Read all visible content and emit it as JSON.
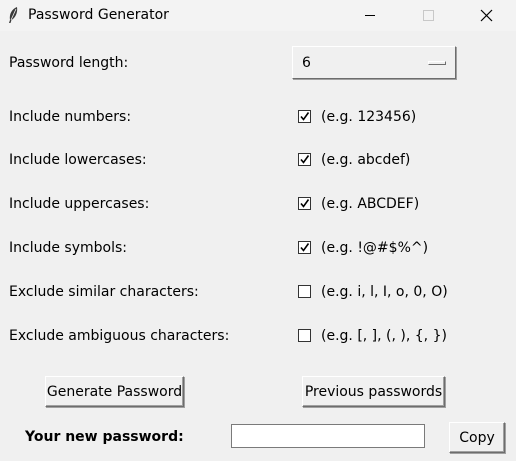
{
  "window": {
    "title": "Password Generator",
    "icon": "feather-icon"
  },
  "length": {
    "label": "Password length:",
    "value": "6"
  },
  "options": [
    {
      "label": "Include numbers:",
      "checked": true,
      "hint": "(e.g. 123456)"
    },
    {
      "label": "Include lowercases:",
      "checked": true,
      "hint": "(e.g. abcdef)"
    },
    {
      "label": "Include uppercases:",
      "checked": true,
      "hint": "(e.g. ABCDEF)"
    },
    {
      "label": "Include symbols:",
      "checked": true,
      "hint": "(e.g. !@#$%^)"
    },
    {
      "label": "Exclude similar characters:",
      "checked": false,
      "hint": "(e.g. i, l, I, o, 0, O)"
    },
    {
      "label": "Exclude ambiguous characters:",
      "checked": false,
      "hint": "(e.g. [, ], (, ), {, })"
    }
  ],
  "buttons": {
    "generate": "Generate Password",
    "previous": "Previous passwords",
    "copy": "Copy"
  },
  "result": {
    "label": "Your new password:",
    "value": ""
  }
}
